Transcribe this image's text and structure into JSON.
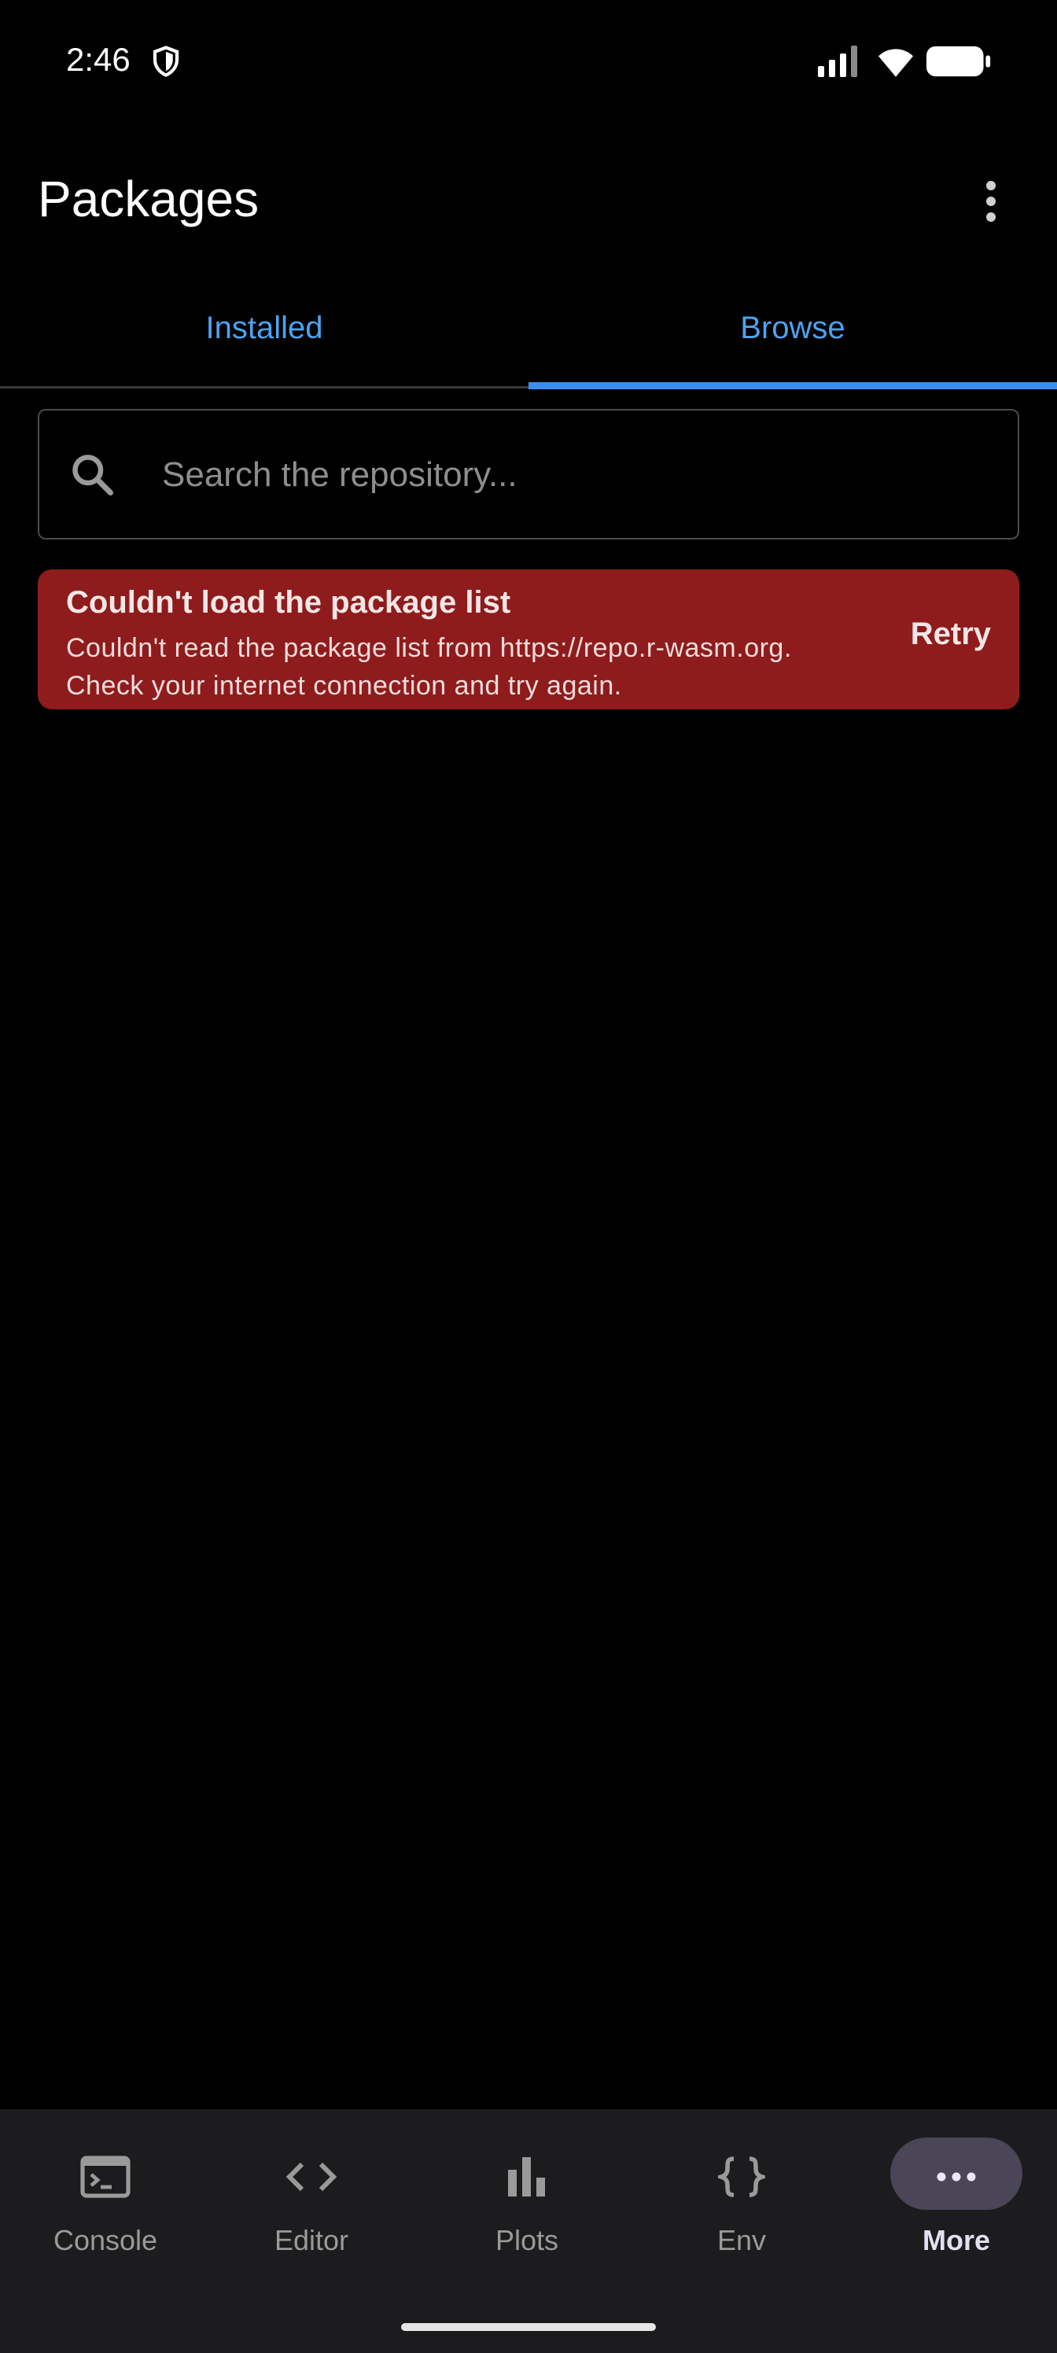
{
  "status_bar": {
    "time": "2:46"
  },
  "header": {
    "title": "Packages"
  },
  "tabs": [
    {
      "label": "Installed",
      "selected": false
    },
    {
      "label": "Browse",
      "selected": true
    }
  ],
  "search": {
    "placeholder": "Search the repository...",
    "value": ""
  },
  "error": {
    "title": "Couldn't load the package list",
    "line1": "Couldn't read the package list from https://repo.r-wasm.org.",
    "line2": "Check your internet connection and try again.",
    "action": "Retry",
    "color": "#8e1c1c"
  },
  "bottom_nav": {
    "items": [
      {
        "label": "Console",
        "icon": "terminal-icon"
      },
      {
        "label": "Editor",
        "icon": "code-icon"
      },
      {
        "label": "Plots",
        "icon": "bar-chart-icon"
      },
      {
        "label": "Env",
        "icon": "braces-icon"
      },
      {
        "label": "More",
        "icon": "more-horizontal-icon",
        "active": true
      }
    ]
  },
  "colors": {
    "accent": "#3a8ef0",
    "tab_text": "#4da3f0",
    "background": "#000000",
    "nav_background": "#1c1c1e"
  }
}
